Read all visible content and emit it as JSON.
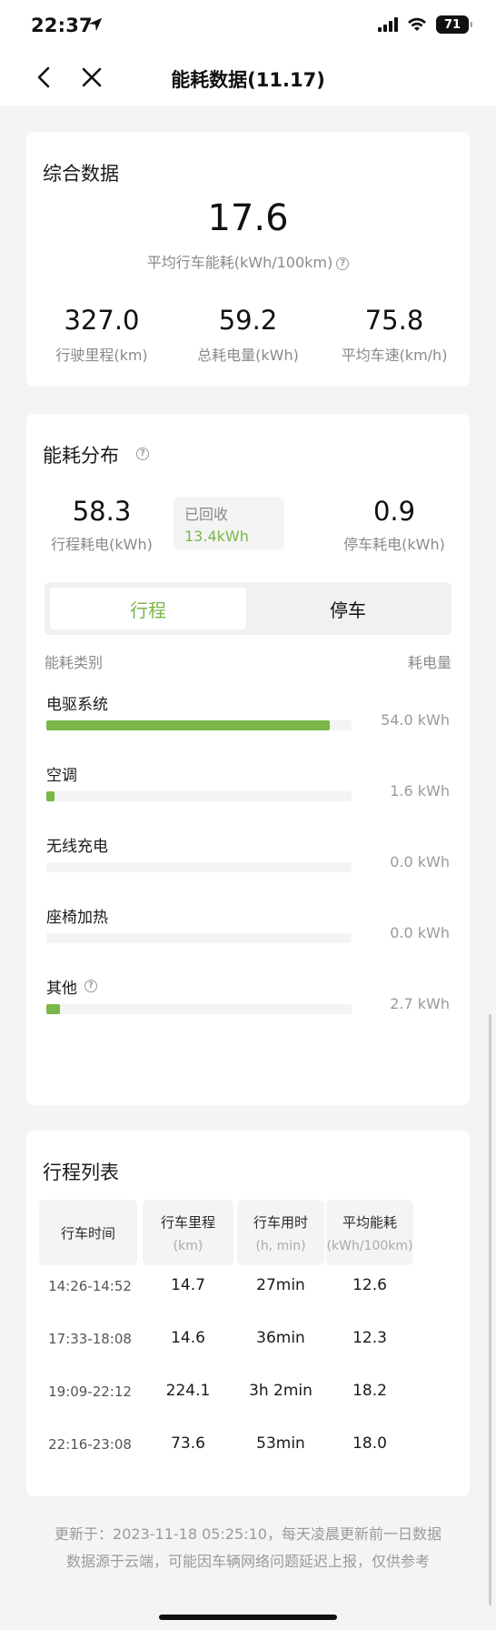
{
  "status_bar": {
    "time": "22:37",
    "battery": "71"
  },
  "nav": {
    "title": "能耗数据(11.17)"
  },
  "summary": {
    "title": "综合数据",
    "avg_consumption": "17.6",
    "avg_consumption_label": "平均行车能耗(kWh/100km)",
    "stats": [
      {
        "value": "327.0",
        "label": "行驶里程(km)"
      },
      {
        "value": "59.2",
        "label": "总耗电量(kWh)"
      },
      {
        "value": "75.8",
        "label": "平均车速(km/h)"
      }
    ]
  },
  "distribution": {
    "title": "能耗分布",
    "drive_value": "58.3",
    "drive_label": "行程耗电(kWh)",
    "recovered_label": "已回收",
    "recovered_value": "13.4kWh",
    "park_value": "0.9",
    "park_label": "停车耗电(kWh)",
    "tabs": {
      "trip": "行程",
      "park": "停车"
    },
    "col_category": "能耗类别",
    "col_consumption": "耗电量",
    "categories": [
      {
        "name": "电驱系统",
        "value": "54.0 kWh",
        "fraction": 0.93
      },
      {
        "name": "空调",
        "value": "1.6 kWh",
        "fraction": 0.028
      },
      {
        "name": "无线充电",
        "value": "0.0 kWh",
        "fraction": 0
      },
      {
        "name": "座椅加热",
        "value": "0.0 kWh",
        "fraction": 0
      },
      {
        "name": "其他",
        "value": "2.7 kWh",
        "fraction": 0.046
      }
    ],
    "accent": "#7ab648"
  },
  "trips": {
    "title": "行程列表",
    "headers": [
      {
        "title": "行车时间",
        "unit": ""
      },
      {
        "title": "行车里程",
        "unit": "(km)"
      },
      {
        "title": "行车用时",
        "unit": "(h, min)"
      },
      {
        "title": "平均能耗",
        "unit": "(kWh/100km)"
      }
    ],
    "rows": [
      [
        "14:26-14:52",
        "14.7",
        "27min",
        "12.6"
      ],
      [
        "17:33-18:08",
        "14.6",
        "36min",
        "12.3"
      ],
      [
        "19:09-22:12",
        "224.1",
        "3h 2min",
        "18.2"
      ],
      [
        "22:16-23:08",
        "73.6",
        "53min",
        "18.0"
      ]
    ]
  },
  "footer": {
    "line1": "更新于：2023-11-18 05:25:10，每天凌晨更新前一日数据",
    "line2": "数据源于云端，可能因车辆网络问题延迟上报，仅供参考"
  }
}
